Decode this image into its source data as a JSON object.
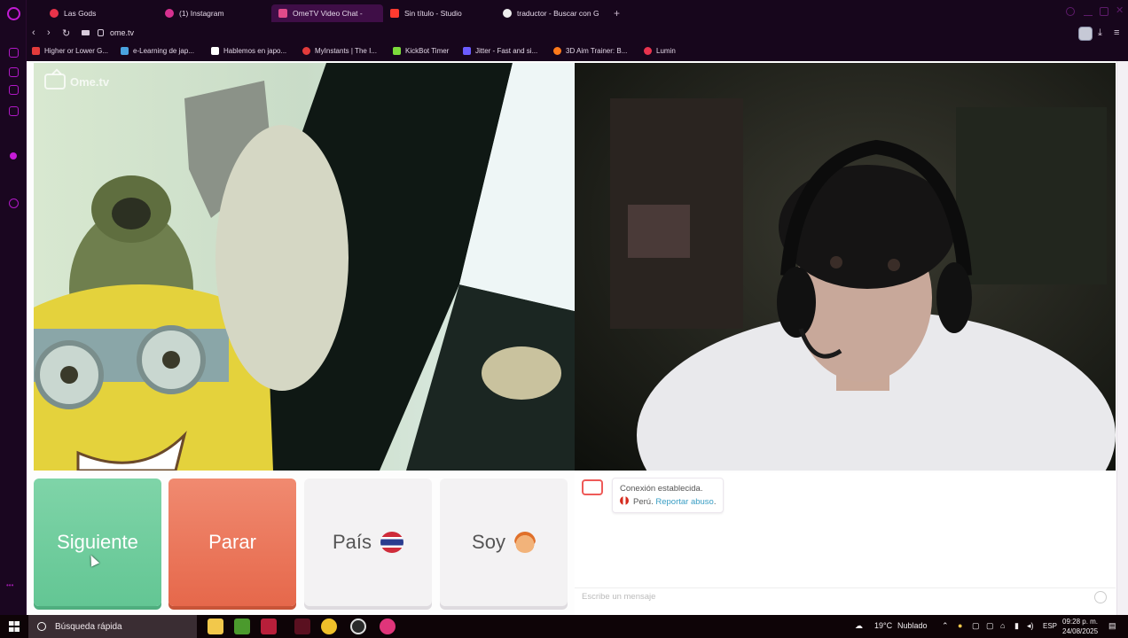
{
  "browser": {
    "tabs": [
      {
        "label": "Las Gods",
        "color": "#e8334a"
      },
      {
        "label": "(1) Instagram",
        "color": "#d6308f"
      },
      {
        "label": "OmeTV Video Chat -",
        "color": "#e04b8b"
      },
      {
        "label": "Sin título - Studio",
        "color": "#ff3b30"
      },
      {
        "label": "traductor - Buscar con G",
        "color": "#eeeeee"
      }
    ],
    "new_tab": "+",
    "url": "ome.tv",
    "bookmarks": [
      {
        "label": "Higher or Lower G...",
        "color": "#e33b3b"
      },
      {
        "label": "e-Learning de jap...",
        "color": "#4aa3df"
      },
      {
        "label": "Hablemos en japo...",
        "color": "#ffffff"
      },
      {
        "label": "MyInstants | The I...",
        "color": "#e23b3b"
      },
      {
        "label": "KickBot Timer",
        "color": "#7cdb3b"
      },
      {
        "label": "Jitter - Fast and si...",
        "color": "#6b5cff"
      },
      {
        "label": "3D Aim Trainer: B...",
        "color": "#ff7a1a"
      },
      {
        "label": "Lumin",
        "color": "#e9334e"
      }
    ]
  },
  "page": {
    "logo_text": "Ome.tv",
    "buttons": {
      "next": "Siguiente",
      "stop": "Parar",
      "country": "País",
      "gender": "Soy"
    },
    "chat": {
      "status": "Conexión establecida.",
      "country": "Perú.",
      "report": "Reportar abuso",
      "report_suffix": ".",
      "placeholder": "Escribe un mensaje"
    }
  },
  "taskbar": {
    "search": "Búsqueda rápida",
    "weather_temp": "19°C",
    "weather_desc": "Nublado",
    "lang": "ESP",
    "time": "09:28 p. m.",
    "date": "24/08/2025"
  }
}
